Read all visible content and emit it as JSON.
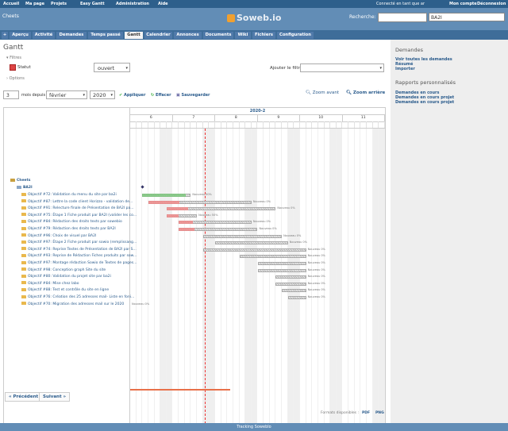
{
  "top_menu": {
    "left": [
      "Accueil",
      "Ma page",
      "Projets",
      "Easy Gantt",
      "Administration",
      "Aide"
    ],
    "logged_in": "Connecté en tant que ar",
    "my_account": "Mon compte",
    "logout": "Déconnexion"
  },
  "header": {
    "project": "Cheets",
    "logo": "Soweb.io",
    "search_label": "Recherche:",
    "search_value": "",
    "project_jump": "BA2I"
  },
  "tabs": [
    "+",
    "Aperçu",
    "Activité",
    "Demandes",
    "Temps passé",
    "Gantt",
    "Calendrier",
    "Annonces",
    "Documents",
    "Wiki",
    "Fichiers",
    "Configuration"
  ],
  "selected_tab": "Gantt",
  "page": {
    "title": "Gantt",
    "filters_label": "Filtres",
    "status_label": "Statut",
    "status_value": "ouvert",
    "add_filter_label": "Ajouter le filtre",
    "options_label": "Options",
    "months_value": "3",
    "months_from_label": "mois depuis",
    "month_value": "février",
    "year_value": "2020",
    "apply": "Appliquer",
    "clear": "Effacer",
    "save": "Sauvegarder",
    "zoom_in": "Zoom avant",
    "zoom_out": "Zoom arrière",
    "prev": "« Précédent",
    "next": "Suivant »",
    "formats_label": "Formats disponibles :",
    "pdf": "PDF",
    "png": "PNG"
  },
  "gantt": {
    "period": "2020-2",
    "weeks": [
      "6",
      "7",
      "8",
      "9",
      "10",
      "11"
    ],
    "project_row": "Cheets",
    "version_row": "BA2I",
    "tasks": [
      {
        "label": "Objectif #72: Validation du menu du site par ba2i",
        "start": 2,
        "end": 10,
        "done": 0.9,
        "color": "#7dc77d",
        "note": "Nouveau 90%"
      },
      {
        "label": "Objectif #87: Lettre la code client Horizzo - validation de...",
        "start": 3,
        "end": 20,
        "done": 0.3,
        "color": "#f08a8a",
        "note": "Nouveau 0%"
      },
      {
        "label": "Objectif #91: Relecture finale de Présentation de BA2I pa...",
        "start": 6,
        "end": 24,
        "done": 0.2,
        "color": "#f08a8a",
        "note": "Nouveau 0%"
      },
      {
        "label": "Objectif #75: Étape 1 Fiche produit par BA2I (valider les co...",
        "start": 6,
        "end": 11,
        "done": 0.4,
        "color": "#f08a8a",
        "note": "Nouveau 50%"
      },
      {
        "label": "Objectif #84: Rédaction des droits texts par sowebio",
        "start": 8,
        "end": 20,
        "done": 0.2,
        "color": "#f08a8a",
        "note": "Nouveau 0%"
      },
      {
        "label": "Objectif #79: Rédaction des droits texts par BA2I",
        "start": 8,
        "end": 21,
        "done": 0.2,
        "color": "#f08a8a",
        "note": "Nouveau 0%"
      },
      {
        "label": "Objectif #96: Choix de visuel par BA2I",
        "start": 12,
        "end": 25,
        "done": 0,
        "color": "#cccccc",
        "note": "Nouveau 0%"
      },
      {
        "label": "Objectif #97: Étape 2 Fiche produit par sowio (remplissang...",
        "start": 14,
        "end": 26,
        "done": 0,
        "color": "#cccccc",
        "note": "Nouveau 0%"
      },
      {
        "label": "Objectif #74: Reprise Textes de Présentation de BA2I par S...",
        "start": 12,
        "end": 29,
        "done": 0,
        "color": "#cccccc",
        "note": "Nouveau 0%"
      },
      {
        "label": "Objectif #93: Reprise de Rédaction Fiches produits par sow...",
        "start": 18,
        "end": 29,
        "done": 0,
        "color": "#cccccc",
        "note": "Nouveau 0%"
      },
      {
        "label": "Objectif #97: Montage rédaction Sowio de Textes de pages...",
        "start": 21,
        "end": 29,
        "done": 0,
        "color": "#cccccc",
        "note": "Nouveau 0%"
      },
      {
        "label": "Objectif #98: Conception graph Site du site",
        "start": 21,
        "end": 29,
        "done": 0,
        "color": "#cccccc",
        "note": "Nouveau 0%"
      },
      {
        "label": "Objectif #80: Validation du projet site par ba2i",
        "start": 24,
        "end": 29,
        "done": 0,
        "color": "#cccccc",
        "note": "Nouveau 0%"
      },
      {
        "label": "Objectif #84: Mise chez labo",
        "start": 24,
        "end": 29,
        "done": 0,
        "color": "#cccccc",
        "note": "Nouveau 0%"
      },
      {
        "label": "Objectif #88: Test et contrôle du site en ligne",
        "start": 25,
        "end": 29,
        "done": 0,
        "color": "#cccccc",
        "note": "Nouveau 0%"
      },
      {
        "label": "Objectif #76: Création des 25 adresses mail- Liste en foni...",
        "start": 26,
        "end": 29,
        "done": 0,
        "color": "#cccccc",
        "note": "Nouveau 0%"
      },
      {
        "label": "Objectif #70: Migration des adresses mail sur le 2020",
        "start": 0,
        "end": 0,
        "done": 0,
        "color": "#cccccc",
        "note": "Nouveau 0%"
      }
    ]
  },
  "sidebar": {
    "requests_title": "Demandes",
    "requests_links": [
      "Voir toutes les demandes",
      "Résumé",
      "Importer"
    ],
    "reports_title": "Rapports personnalisés",
    "reports_links": [
      "Demandes en cours",
      "Demandes en cours projet",
      "Demandes en cours projet"
    ]
  },
  "footer": "Tracking Soweblo"
}
